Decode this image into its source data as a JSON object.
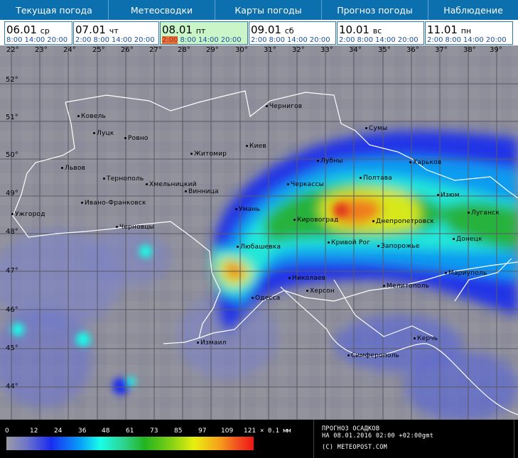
{
  "nav": {
    "items": [
      "Текущая погода",
      "Метеосводки",
      "Карты погоды",
      "Прогноз погоды",
      "Наблюдение"
    ]
  },
  "days": [
    {
      "date": "06.01",
      "dow": "ср",
      "times": [
        "8:00",
        "14:00",
        "20:00"
      ],
      "active": false
    },
    {
      "date": "07.01",
      "dow": "чт",
      "times": [
        "2:00",
        "8:00",
        "14:00",
        "20:00"
      ],
      "active": false
    },
    {
      "date": "08.01",
      "dow": "пт",
      "times": [
        "2:00",
        "8:00",
        "14:00",
        "20:00"
      ],
      "active": true,
      "selected_time": "2:00"
    },
    {
      "date": "09.01",
      "dow": "сб",
      "times": [
        "2:00",
        "8:00",
        "14:00",
        "20:00"
      ],
      "active": false
    },
    {
      "date": "10.01",
      "dow": "вс",
      "times": [
        "2:00",
        "8:00",
        "14:00",
        "20:00"
      ],
      "active": false
    },
    {
      "date": "11.01",
      "dow": "пн",
      "times": [
        "2:00",
        "8:00",
        "14:00",
        "20:00"
      ],
      "active": false
    }
  ],
  "map": {
    "longitudes": [
      "22°",
      "23°",
      "24°",
      "25°",
      "26°",
      "27°",
      "28°",
      "29°",
      "30°",
      "31°",
      "32°",
      "33°",
      "34°",
      "35°",
      "36°",
      "37°",
      "38°",
      "39°"
    ],
    "latitudes": [
      "52°",
      "51°",
      "50°",
      "49°",
      "48°",
      "47°",
      "46°",
      "45°",
      "44°"
    ],
    "cities": [
      "Чернигов",
      "Ковель",
      "Луцк",
      "Ровно",
      "Сумы",
      "Житомир",
      "Киев",
      "Лубны",
      "Харьков",
      "Львов",
      "Тернополь",
      "Хмельницкий",
      "Полтава",
      "Винница",
      "Черкассы",
      "Изюм",
      "Ивано-Франковск",
      "Умань",
      "Луганск",
      "Ужгород",
      "Кировоград",
      "Днепропетровск",
      "Черновцы",
      "Кривой Рог",
      "Запорожье",
      "Донецк",
      "Любашевка",
      "Мариуполь",
      "Николаев",
      "Мелитополь",
      "Херсон",
      "Одесса",
      "Керчь",
      "Измаил",
      "Симферополь"
    ]
  },
  "legend": {
    "ticks": [
      "0",
      "12",
      "24",
      "36",
      "48",
      "61",
      "73",
      "85",
      "97",
      "109",
      "121"
    ],
    "unit": "× 0.1 мм",
    "title": "ПРОГНОЗ ОСАДКОВ",
    "date_line": "НА 08.01.2016 02:00 +02:00gmt",
    "copyright": "(C) METEOPOST.COM",
    "colors": [
      "#9a9aa6",
      "#1a2cf0",
      "#19ffe8",
      "#22b41f",
      "#e8ef10",
      "#f01414"
    ]
  }
}
